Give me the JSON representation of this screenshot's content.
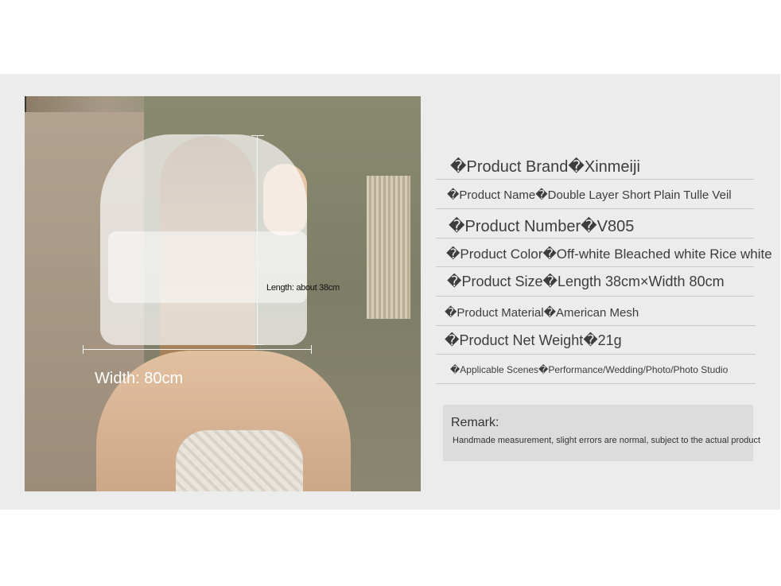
{
  "image": {
    "length_label": "Length: about 38cm",
    "width_label": "Width: 80cm"
  },
  "specs": [
    "�Product Brand�Xinmeiji",
    "�Product Name�Double Layer Short Plain Tulle Veil",
    "�Product Number�V805",
    "�Product Color�Off-white Bleached white Rice white",
    "�Product Size�Length 38cm×Width 80cm",
    "�Product Material�American Mesh",
    "�Product Net Weight�21g",
    "�Applicable Scenes�Performance/Wedding/Photo/Photo Studio"
  ],
  "remark": {
    "title": "Remark:",
    "text": "Handmade measurement, slight errors are normal, subject to the actual product"
  }
}
